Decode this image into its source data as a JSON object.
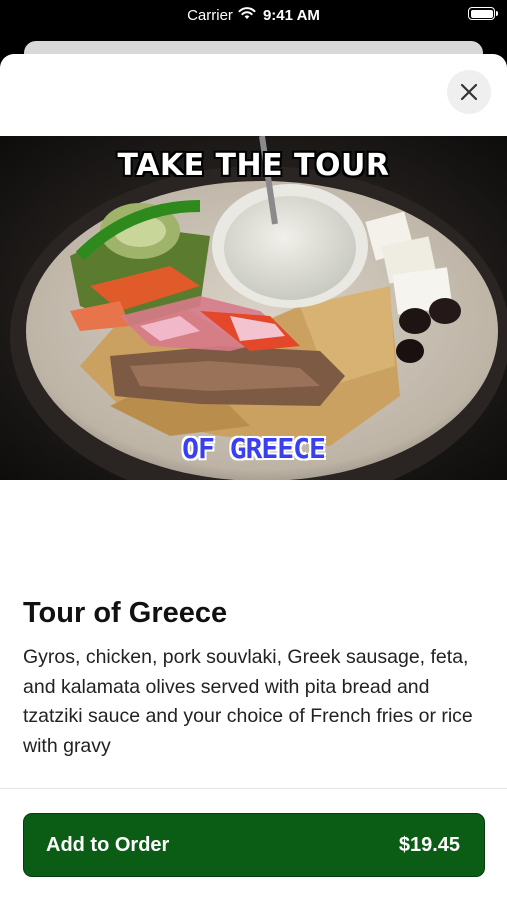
{
  "status_bar": {
    "carrier": "Carrier",
    "time": "9:41 AM",
    "icons": [
      "wifi-icon",
      "battery-icon"
    ]
  },
  "modal": {
    "close_icon": "close-icon"
  },
  "hero_image": {
    "overlay_top": "TAKE THE TOUR",
    "overlay_bottom": "OF GREECE"
  },
  "item": {
    "title": "Tour of Greece",
    "description": "Gyros, chicken, pork souvlaki, Greek sausage, feta, and kalamata olives served with pita bread and tzatziki sauce and your choice of French fries or rice with gravy"
  },
  "add_to_order": {
    "label": "Add to Order",
    "price": "$19.45",
    "color": "#0b5d16"
  }
}
